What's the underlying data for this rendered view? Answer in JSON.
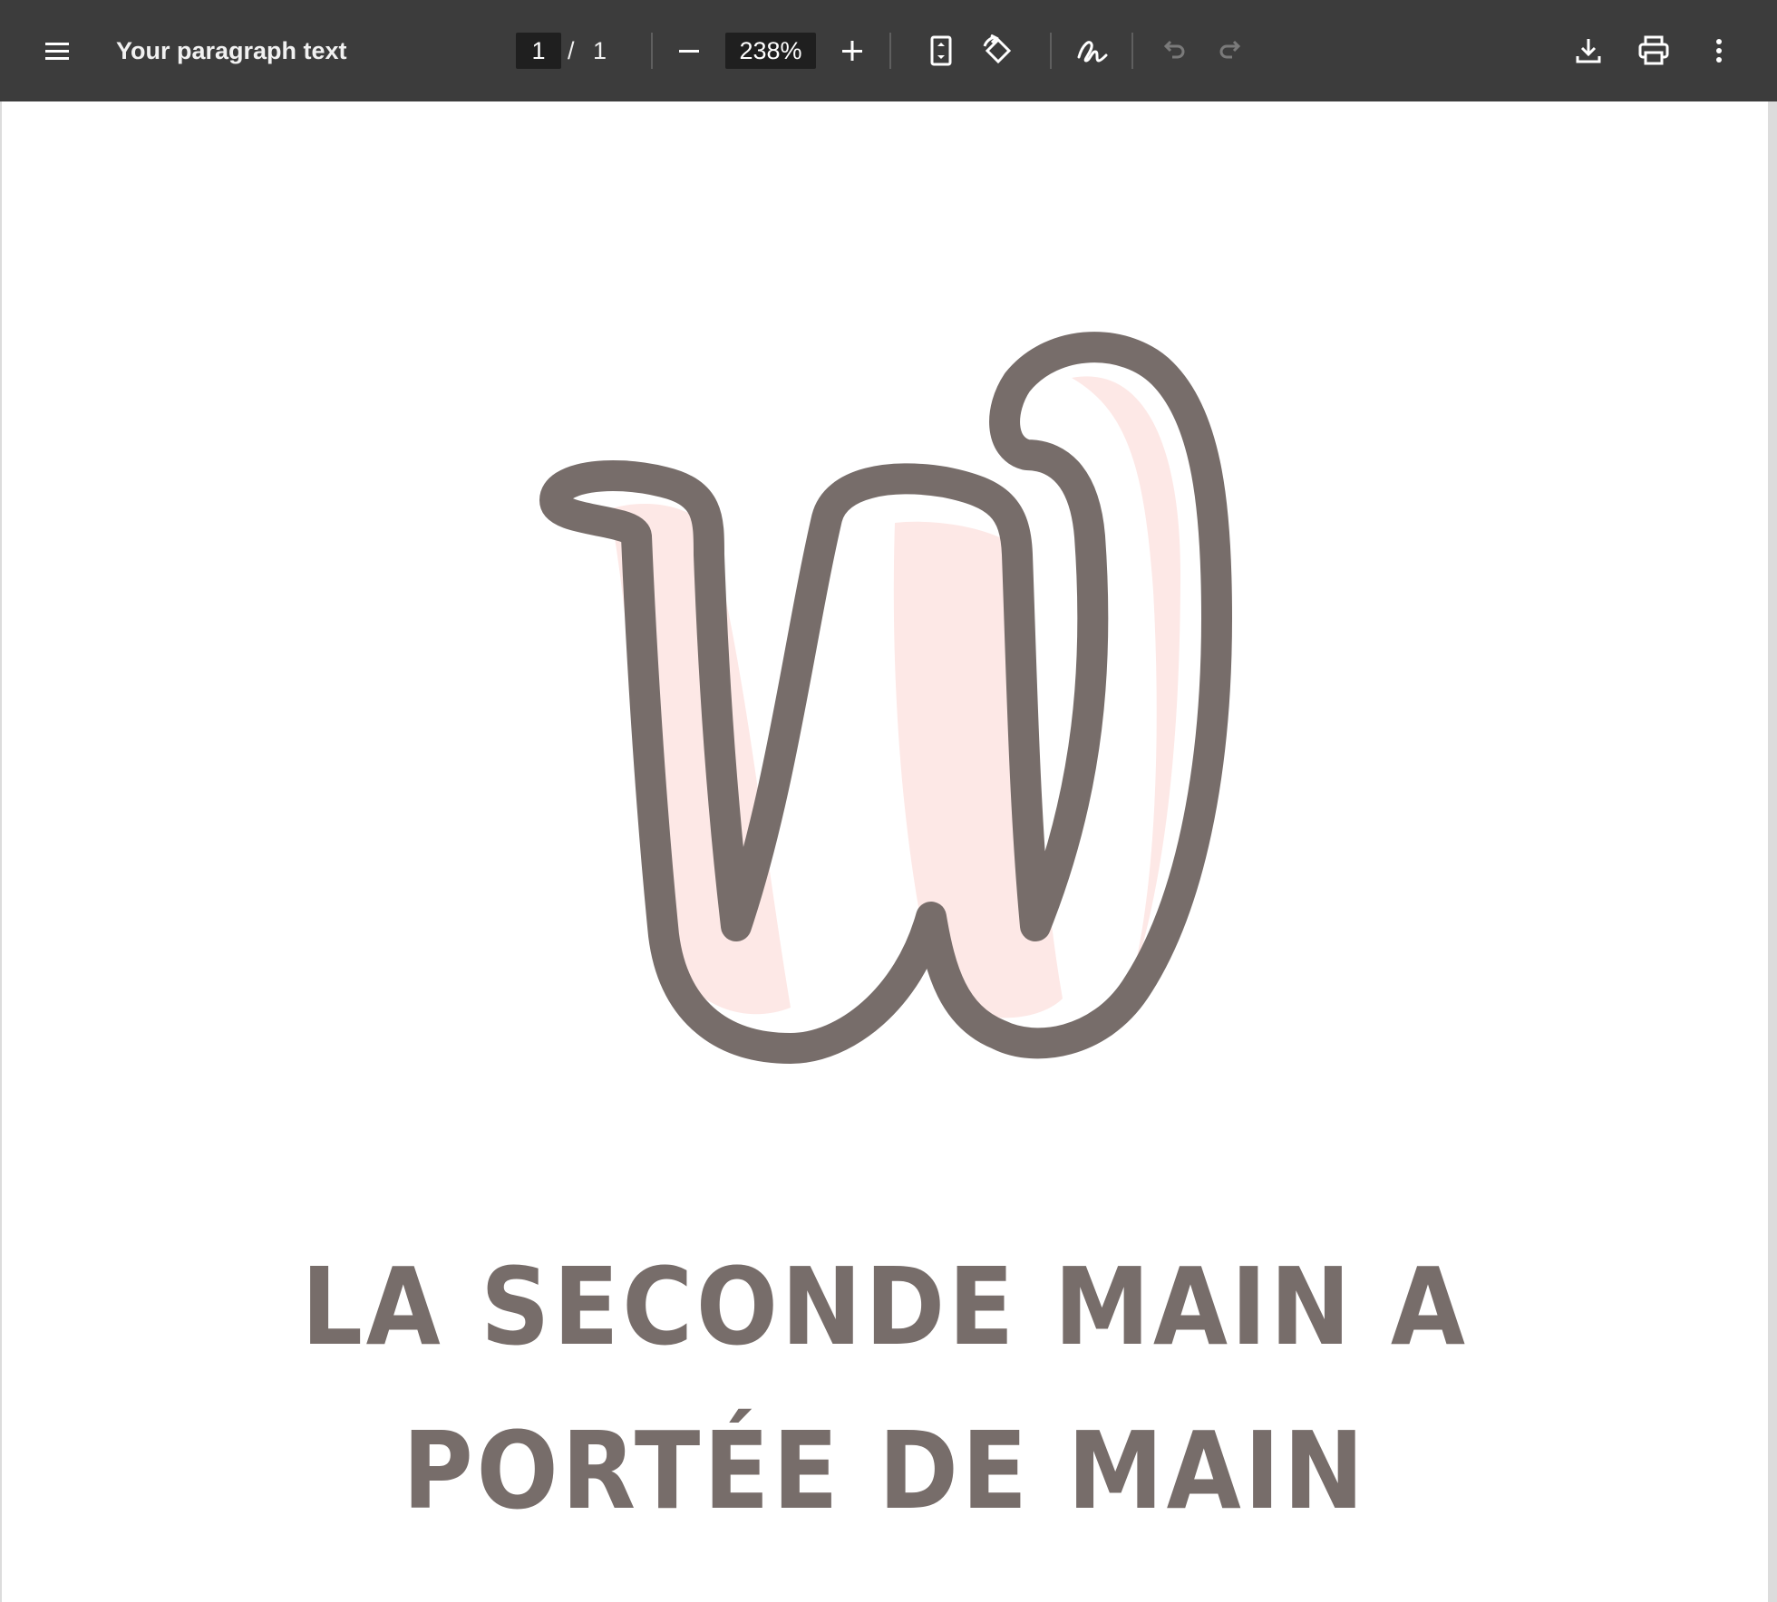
{
  "toolbar": {
    "menu_icon": "hamburger-menu-icon",
    "title": "Your paragraph text",
    "page_current": "1",
    "page_separator": "/",
    "page_total": "1",
    "zoom_value": "238%",
    "icons": [
      "zoom-out-icon",
      "zoom-in-icon",
      "fit-page-icon",
      "rotate-icon",
      "annotate-icon",
      "undo-icon",
      "redo-icon",
      "download-icon",
      "print-icon",
      "more-options-icon"
    ]
  },
  "document": {
    "logo": "w-letter-logo",
    "headline_line1": "LA SECONDE MAIN A",
    "headline_line2": "PORTÉE DE MAIN"
  },
  "colors": {
    "toolbar_bg": "#3c3c3c",
    "field_bg": "#1f1f1f",
    "text_grey": "#776d6a",
    "logo_fill": "#fde8e6"
  }
}
